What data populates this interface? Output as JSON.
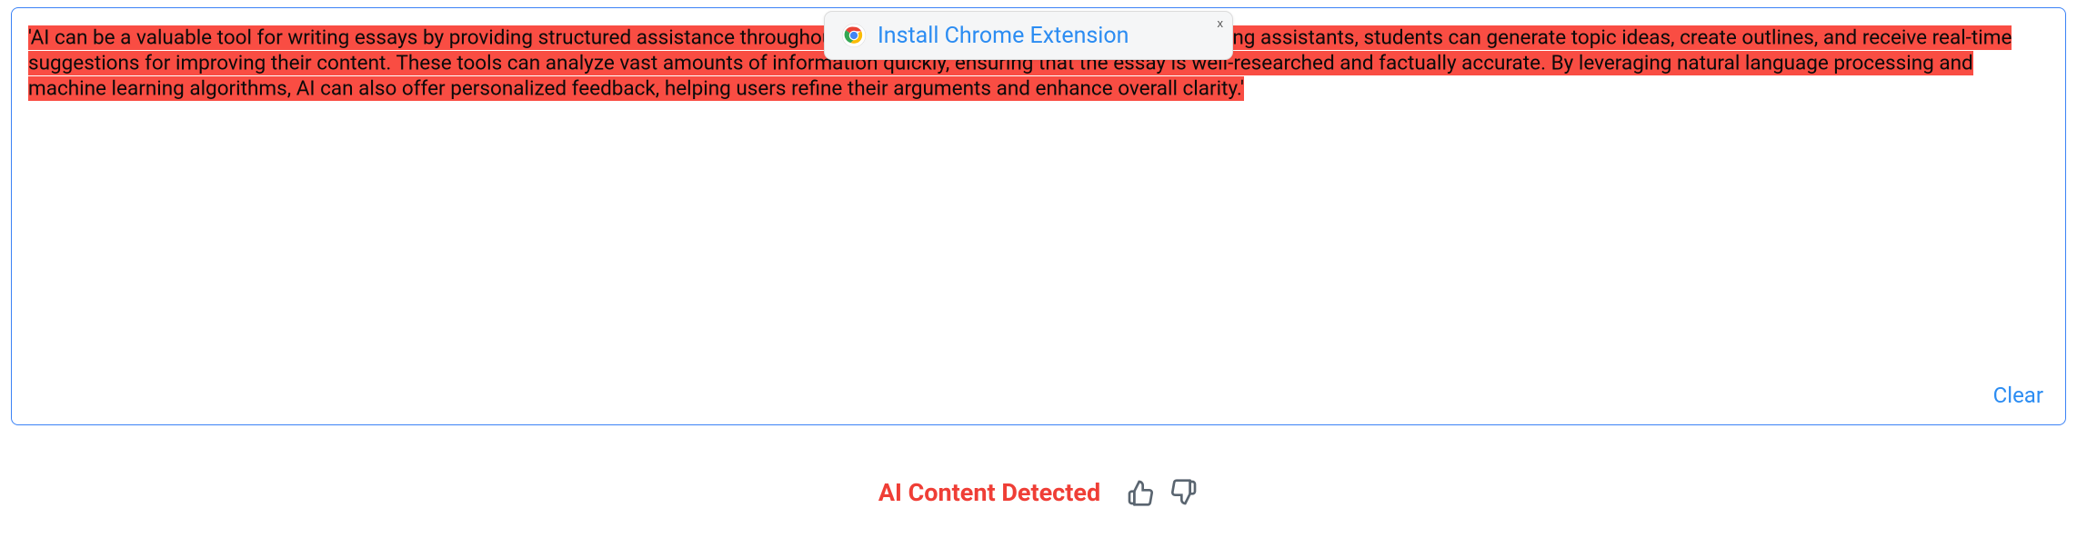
{
  "editor": {
    "highlighted_text": "'AI can be a valuable tool for writing essays by providing structured assistance throughout the writing process. Using AI-powered writing assistants, students can generate topic ideas, create outlines, and receive real-time suggestions for improving their content. These tools can analyze vast amounts of information quickly, ensuring that the essay is well-researched and factually accurate. By leveraging natural language processing and machine learning algorithms, AI can also offer personalized feedback, helping users refine their arguments and enhance overall clarity.'",
    "clear_label": "Clear"
  },
  "extension_popup": {
    "label": "Install Chrome Extension",
    "close_label": "x"
  },
  "result": {
    "status_text": "AI Content Detected"
  },
  "colors": {
    "highlight": "#f94d43",
    "link": "#2b8cf2",
    "detected": "#ef3e36",
    "border": "#3b82f6"
  }
}
